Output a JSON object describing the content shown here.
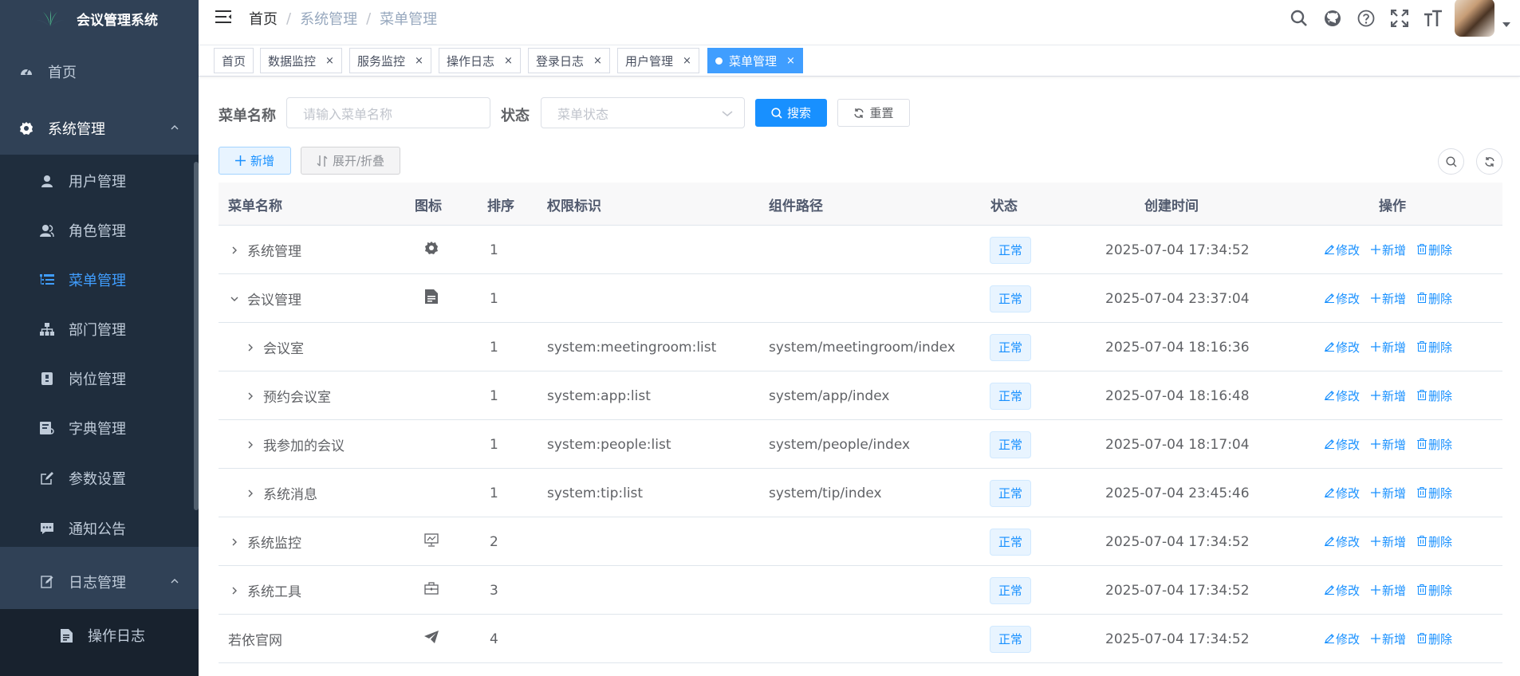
{
  "app": {
    "title": "会议管理系统"
  },
  "sidebar": {
    "items": [
      {
        "label": "首页",
        "icon": "dashboard-icon"
      },
      {
        "label": "系统管理",
        "icon": "gear-icon"
      },
      {
        "label": "用户管理",
        "icon": "user-icon"
      },
      {
        "label": "角色管理",
        "icon": "peoples-icon"
      },
      {
        "label": "菜单管理",
        "icon": "tree-table-icon"
      },
      {
        "label": "部门管理",
        "icon": "tree-icon"
      },
      {
        "label": "岗位管理",
        "icon": "post-icon"
      },
      {
        "label": "字典管理",
        "icon": "dict-icon"
      },
      {
        "label": "参数设置",
        "icon": "edit-icon"
      },
      {
        "label": "通知公告",
        "icon": "message-icon"
      },
      {
        "label": "日志管理",
        "icon": "log-icon"
      },
      {
        "label": "操作日志",
        "icon": "form-icon"
      }
    ]
  },
  "breadcrumb": [
    "首页",
    "系统管理",
    "菜单管理"
  ],
  "tags": [
    {
      "label": "首页"
    },
    {
      "label": "数据监控"
    },
    {
      "label": "服务监控"
    },
    {
      "label": "操作日志"
    },
    {
      "label": "登录日志"
    },
    {
      "label": "用户管理"
    },
    {
      "label": "菜单管理"
    }
  ],
  "search": {
    "name_label": "菜单名称",
    "name_placeholder": "请输入菜单名称",
    "status_label": "状态",
    "status_placeholder": "菜单状态",
    "search_button": "搜索",
    "reset_button": "重置"
  },
  "toolbar": {
    "add_button": "新增",
    "expand_button": "展开/折叠"
  },
  "table": {
    "headers": [
      "菜单名称",
      "图标",
      "排序",
      "权限标识",
      "组件路径",
      "状态",
      "创建时间",
      "操作"
    ],
    "rows": [
      {
        "name": "系统管理",
        "icon": "gear-icon",
        "order": "1",
        "perms": "",
        "component": "",
        "status": "正常",
        "created": "2025-07-04 17:34:52"
      },
      {
        "name": "会议管理",
        "icon": "document-icon",
        "order": "1",
        "perms": "",
        "component": "",
        "status": "正常",
        "created": "2025-07-04 23:37:04"
      },
      {
        "name": "会议室",
        "icon": "",
        "order": "1",
        "perms": "system:meetingroom:list",
        "component": "system/meetingroom/index",
        "status": "正常",
        "created": "2025-07-04 18:16:36"
      },
      {
        "name": "预约会议室",
        "icon": "",
        "order": "1",
        "perms": "system:app:list",
        "component": "system/app/index",
        "status": "正常",
        "created": "2025-07-04 18:16:48"
      },
      {
        "name": "我参加的会议",
        "icon": "",
        "order": "1",
        "perms": "system:people:list",
        "component": "system/people/index",
        "status": "正常",
        "created": "2025-07-04 18:17:04"
      },
      {
        "name": "系统消息",
        "icon": "",
        "order": "1",
        "perms": "system:tip:list",
        "component": "system/tip/index",
        "status": "正常",
        "created": "2025-07-04 23:45:46"
      },
      {
        "name": "系统监控",
        "icon": "monitor-icon",
        "order": "2",
        "perms": "",
        "component": "",
        "status": "正常",
        "created": "2025-07-04 17:34:52"
      },
      {
        "name": "系统工具",
        "icon": "toolbox-icon",
        "order": "3",
        "perms": "",
        "component": "",
        "status": "正常",
        "created": "2025-07-04 17:34:52"
      },
      {
        "name": "若依官网",
        "icon": "send-icon",
        "order": "4",
        "perms": "",
        "component": "",
        "status": "正常",
        "created": "2025-07-04 17:34:52"
      }
    ],
    "ops": {
      "edit": "修改",
      "add": "新增",
      "delete": "删除"
    }
  },
  "colors": {
    "sidebar_bg": "#304156",
    "submenu_bg": "#1f2d3d",
    "primary": "#1890ff",
    "active_menu": "#409eff"
  }
}
